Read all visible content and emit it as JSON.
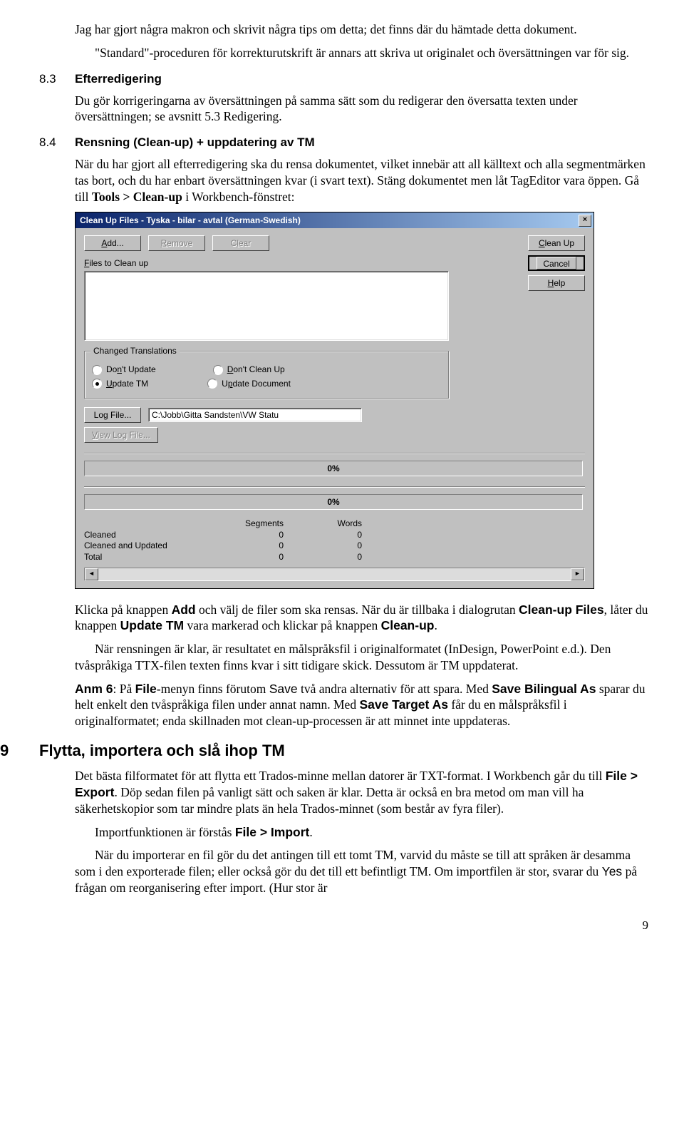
{
  "intro": {
    "p1": "Jag har gjort några makron och skrivit några tips om detta; det finns där du hämtade detta dokument.",
    "p2": "\"Standard\"-proceduren för korrekturutskrift är annars att skriva ut originalet och översättningen var för sig."
  },
  "sec83": {
    "num": "8.3",
    "title": "Efterredigering",
    "body": "Du gör korrigeringarna av översättningen på samma sätt som du redigerar den översatta texten under översättningen; se avsnitt 5.3 Redigering."
  },
  "sec84": {
    "num": "8.4",
    "title": "Rensning (Clean-up) + uppdatering av TM",
    "p1a": "När du har gjort all efterredigering ska du rensa dokumentet, vilket innebär att all källtext och alla segmentmärken tas bort, och du har enbart översättningen kvar (i svart text). Stäng dokumentet men låt TagEditor vara öppen. Gå till ",
    "p1b": "Tools > Clean-up",
    "p1c": " i Workbench-fönstret:"
  },
  "dialog": {
    "title": "Clean Up Files - Tyska - bilar - avtal  (German-Swedish)",
    "close": "×",
    "buttons": {
      "add": "Add...",
      "remove": "Remove",
      "clear": "Clear",
      "cleanup": "Clean Up",
      "cancel": "Cancel",
      "help": "Help",
      "logfile": "Log File...",
      "viewlog": "View Log File..."
    },
    "labels": {
      "files": "Files to Clean up",
      "group": "Changed Translations",
      "r1": "Don't Update",
      "r2": "Don't Clean Up",
      "r3": "Update TM",
      "r4": "Update Document"
    },
    "logpath": "C:\\Jobb\\Gitta Sandsten\\VW Statu",
    "progress1": "0%",
    "progress2": "0%",
    "summary": {
      "h_seg": "Segments",
      "h_words": "Words",
      "rows": [
        {
          "label": "Cleaned",
          "seg": "0",
          "words": "0"
        },
        {
          "label": "Cleaned and Updated",
          "seg": "0",
          "words": "0"
        },
        {
          "label": "Total",
          "seg": "0",
          "words": "0"
        }
      ]
    },
    "arrows": {
      "left": "◄",
      "right": "►"
    }
  },
  "after": {
    "p1a": "Klicka på knappen ",
    "p1b": "Add",
    "p1c": " och välj de filer som ska rensas. När du är tillbaka i dialogrutan ",
    "p1d": "Clean-up Files",
    "p1e": ", låter du knappen ",
    "p1f": "Update TM",
    "p1g": " vara markerad och klickar på knappen ",
    "p1h": "Clean-up",
    "p1i": ".",
    "p2": "När rensningen är klar, är resultatet en målspråksfil i originalformatet (InDesign, PowerPoint e.d.). Den tvåspråkiga TTX-filen texten finns kvar i sitt tidigare skick. Dessutom är TM uppdaterat.",
    "anm_a": "Anm 6",
    "anm_b": ": På ",
    "anm_c": "File",
    "anm_d": "-menyn finns förutom ",
    "anm_e": "Save",
    "anm_f": " två andra alternativ för att spara. Med ",
    "anm_g": "Save Bilingual As",
    "anm_h": " sparar du helt enkelt den tvåspråkiga filen under annat namn. Med ",
    "anm_i": "Save Target As",
    "anm_j": " får du en målspråksfil i originalformatet; enda skillnaden mot clean-up-processen är att minnet inte uppdateras."
  },
  "sec9": {
    "num": "9",
    "title": "Flytta, importera och slå ihop TM",
    "p1a": "Det bästa filformatet för att flytta ett Trados-minne mellan datorer är TXT-format. I Workbench går du till ",
    "p1b": "File > Export",
    "p1c": ". Döp sedan filen på vanligt sätt och saken är klar. Detta är också en bra metod om man vill ha säkerhetskopior som tar mindre plats än hela Trados-minnet (som består av fyra filer).",
    "p2a": "Importfunktionen är förstås ",
    "p2b": "File > Import",
    "p2c": ".",
    "p3a": "När du importerar en fil gör du det antingen till ett tomt TM, varvid du måste se till att språken är desamma som i den exporterade filen; eller också gör du det till ett befintligt TM. Om importfilen är stor, svarar du ",
    "p3b": "Yes",
    "p3c": " på frågan om reorganisering efter import. (Hur stor är"
  },
  "pagenum": "9"
}
